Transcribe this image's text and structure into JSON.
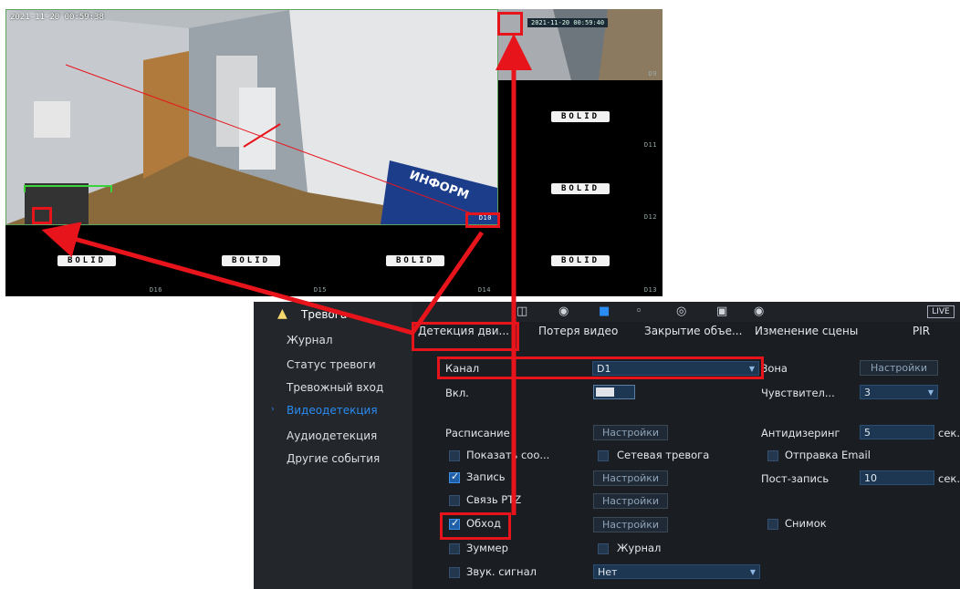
{
  "camera_view": {
    "main": {
      "timestamp": "2021-11-20 00:59:38",
      "channel": "D10",
      "sign_text": "ИНФОРМ"
    },
    "side_tiles": [
      {
        "channel": "D9",
        "timestamp": "2021-11-20 00:59:40"
      },
      {
        "channel": "D11",
        "logo": "BOLID"
      },
      {
        "channel": "D12",
        "logo": "BOLID"
      },
      {
        "channel": "D13",
        "logo": "BOLID"
      }
    ],
    "bottom_tiles": [
      {
        "channel": "D16",
        "logo": "BOLID"
      },
      {
        "channel": "D15",
        "logo": "BOLID"
      },
      {
        "channel": "D14",
        "logo": "BOLID"
      }
    ]
  },
  "nvr": {
    "title": "Тревога",
    "live_label": "LIVE",
    "menu": [
      "Журнал",
      "Статус тревоги",
      "Тревожный вход",
      "Видеодетекция",
      "Аудиодетекция",
      "Другие события"
    ],
    "active_menu": "Видеодетекция",
    "tabs": [
      "Детекция дви...",
      "Потеря видео",
      "Закрытие объе...",
      "Изменение сцены",
      "PIR"
    ],
    "channel_label": "Канал",
    "channel_value": "D1",
    "zone_label": "Зона",
    "settings_label": "Настройки",
    "enable_label": "Вкл.",
    "sensitivity_label": "Чувствител...",
    "sensitivity_value": "3",
    "schedule_label": "Расписание",
    "antidither_label": "Антидизеринг",
    "antidither_value": "5",
    "sec_unit": "сек.",
    "show_msg_label": "Показать соо...",
    "net_alarm_label": "Сетевая тревога",
    "send_email_label": "Отправка Email",
    "record_label": "Запись",
    "post_record_label": "Пост-запись",
    "post_record_value": "10",
    "ptz_label": "Связь PTZ",
    "tour_label": "Обход",
    "snapshot_label": "Снимок",
    "buzzer_label": "Зуммер",
    "log_label": "Журнал",
    "sound_label": "Звук. сигнал",
    "sound_value": "Нет"
  },
  "colors": {
    "highlight_red": "#e8141b",
    "active_blue": "#2a8cf2"
  }
}
